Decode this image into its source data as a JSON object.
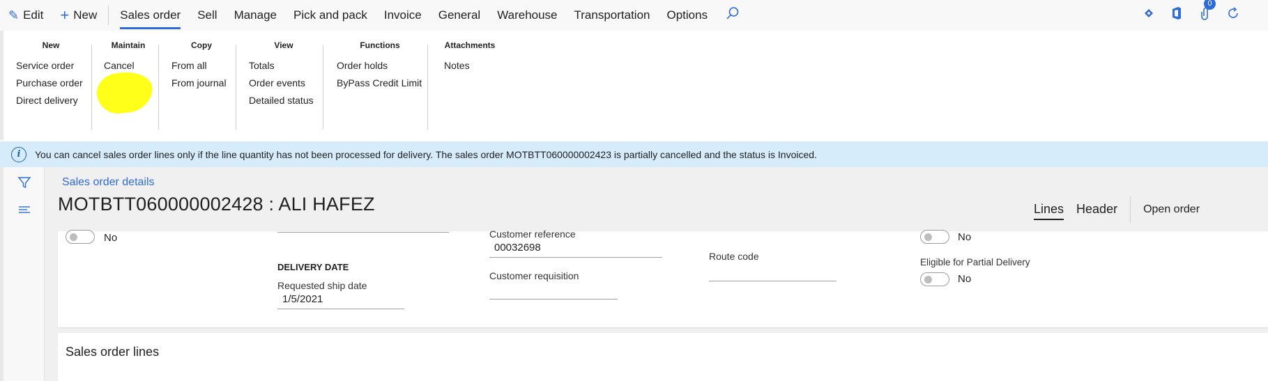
{
  "topbar": {
    "edit_label": "Edit",
    "new_label": "New",
    "tabs": [
      {
        "label": "Sales order"
      },
      {
        "label": "Sell"
      },
      {
        "label": "Manage"
      },
      {
        "label": "Pick and pack"
      },
      {
        "label": "Invoice"
      },
      {
        "label": "General"
      },
      {
        "label": "Warehouse"
      },
      {
        "label": "Transportation"
      },
      {
        "label": "Options"
      }
    ],
    "active_tab": "Sales order",
    "notification_count": "0",
    "accent_color": "#2e6bd8"
  },
  "ribbon": {
    "groups": [
      {
        "title": "New",
        "items": [
          "Service order",
          "Purchase order",
          "Direct delivery"
        ]
      },
      {
        "title": "Maintain",
        "items": [
          "Cancel"
        ]
      },
      {
        "title": "Copy",
        "items": [
          "From all",
          "From journal"
        ]
      },
      {
        "title": "View",
        "items": [
          "Totals",
          "Order events",
          "Detailed status"
        ]
      },
      {
        "title": "Functions",
        "items": [
          "Order holds",
          "ByPass Credit Limit"
        ]
      },
      {
        "title": "Attachments",
        "items": [
          "Notes"
        ]
      }
    ],
    "highlight_color": "#ffff1a"
  },
  "infobar": {
    "message": "You can cancel sales order lines only if the line quantity has not been processed for delivery. The sales order MOTBTT060000002423 is partially cancelled and the status is Invoiced.",
    "background": "#d6ecfb"
  },
  "page": {
    "breadcrumb": "Sales order details",
    "title": "MOTBTT060000002428 : ALI HAFEZ",
    "view_tabs": [
      {
        "label": "Lines"
      },
      {
        "label": "Header"
      }
    ],
    "active_view": "Lines",
    "open_order_label": "Open order"
  },
  "header": {
    "toggle1_value": "No",
    "delivery_date_heading": "DELIVERY DATE",
    "requested_ship_date_label": "Requested ship date",
    "requested_ship_date_value": "1/5/2021",
    "customer_reference_label": "Customer reference",
    "customer_reference_value": "00032698",
    "customer_requisition_label": "Customer requisition",
    "customer_requisition_value": "",
    "route_code_label": "Route code",
    "route_code_value": "",
    "toggle2_value": "No",
    "partial_delivery_label": "Eligible for Partial Delivery",
    "partial_delivery_value": "No"
  },
  "lines": {
    "title": "Sales order lines"
  }
}
